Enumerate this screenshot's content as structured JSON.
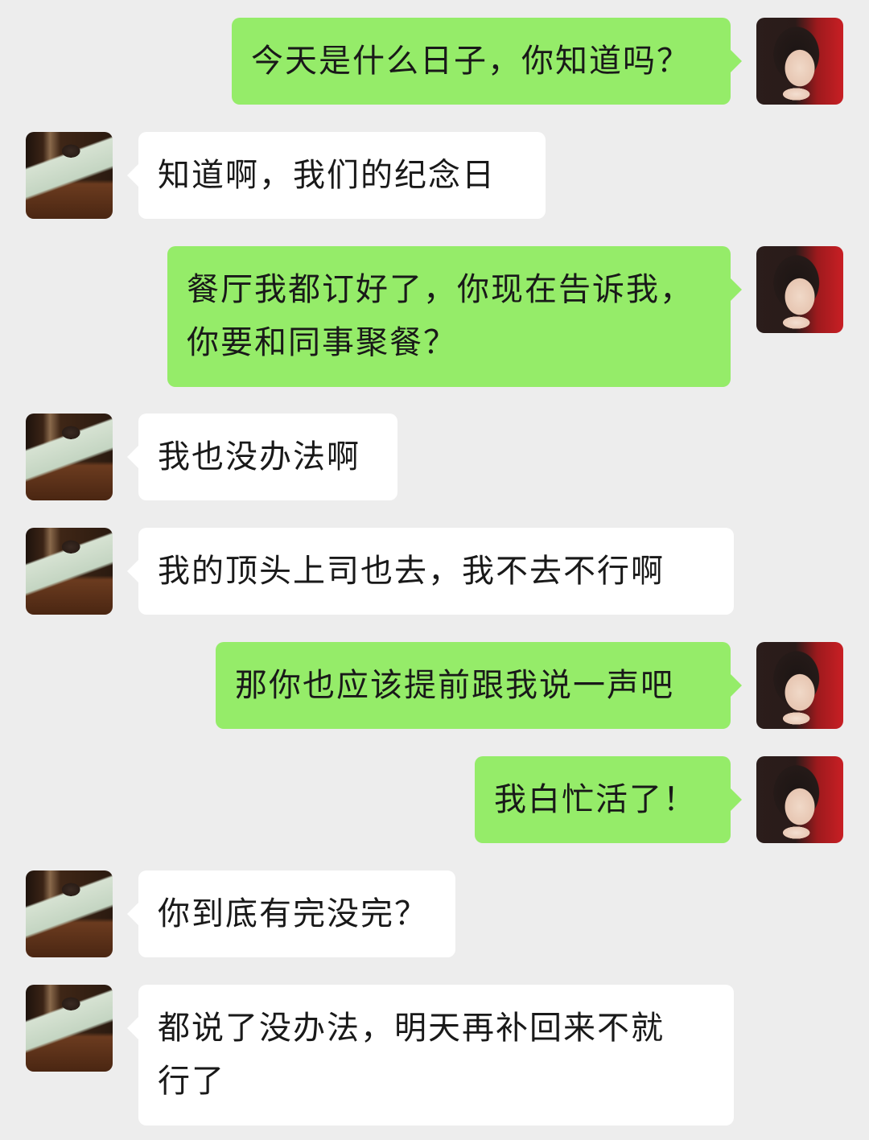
{
  "messages": [
    {
      "side": "out",
      "text": "今天是什么日子，你知道吗？"
    },
    {
      "side": "in",
      "text": "知道啊，我们的纪念日"
    },
    {
      "side": "out",
      "text": "餐厅我都订好了，你现在告诉我，\n你要和同事聚餐？"
    },
    {
      "side": "in",
      "text": "我也没办法啊"
    },
    {
      "side": "in",
      "text": "我的顶头上司也去，我不去不行啊"
    },
    {
      "side": "out",
      "text": "那你也应该提前跟我说一声吧"
    },
    {
      "side": "out",
      "text": "我白忙活了！"
    },
    {
      "side": "in",
      "text": "你到底有完没完？"
    },
    {
      "side": "in",
      "text": "都说了没办法，明天再补回来不就\n行了"
    }
  ],
  "colors": {
    "background": "#ededed",
    "sent_bubble": "#95ec69",
    "received_bubble": "#ffffff",
    "text": "#191919"
  },
  "icons": {
    "sent_avatar": "female-avatar-photo",
    "received_avatar": "male-avatar-photo"
  }
}
